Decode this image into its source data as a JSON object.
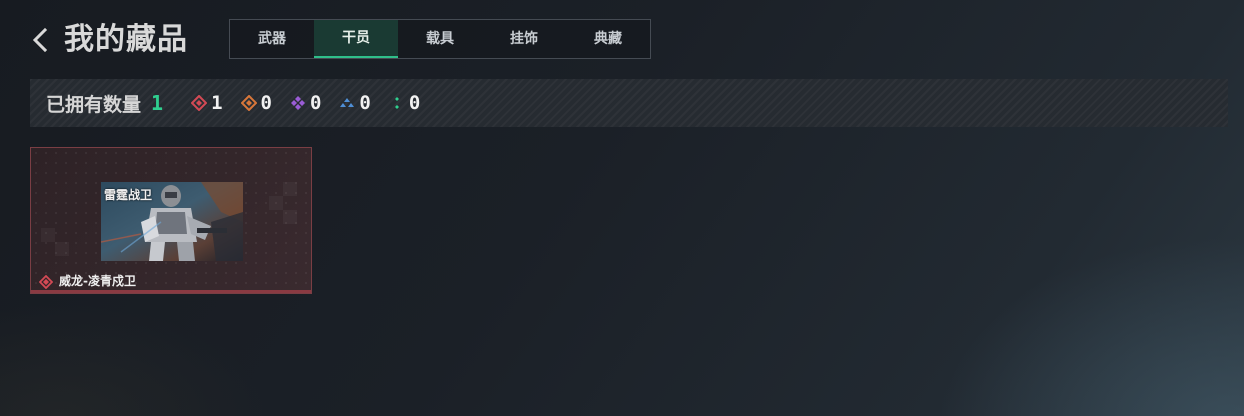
{
  "header": {
    "title": "我的藏品"
  },
  "tabs": [
    {
      "label": "武器",
      "active": false
    },
    {
      "label": "干员",
      "active": true
    },
    {
      "label": "载具",
      "active": false
    },
    {
      "label": "挂饰",
      "active": false
    },
    {
      "label": "典藏",
      "active": false
    }
  ],
  "stats": {
    "label": "已拥有数量",
    "total": "1",
    "rarities": [
      {
        "icon": "red-diamond-icon",
        "color": "#d44a55",
        "count": "1"
      },
      {
        "icon": "orange-diamond-icon",
        "color": "#d9773a",
        "count": "0"
      },
      {
        "icon": "purple-diamond-icon",
        "color": "#9a5cd6",
        "count": "0"
      },
      {
        "icon": "blue-triangle-icon",
        "color": "#4f8fd6",
        "count": "0"
      },
      {
        "icon": "green-dots-icon",
        "color": "#2fcf8f",
        "count": "0"
      }
    ]
  },
  "items": [
    {
      "name": "威龙-凌青戍卫",
      "rarity_icon": "red-diamond-icon",
      "rarity_color": "#d44a55",
      "thumb_logo": "雷霆战卫"
    }
  ],
  "colors": {
    "accent_green": "#2fcf8f",
    "card_border": "#7a3e44"
  }
}
